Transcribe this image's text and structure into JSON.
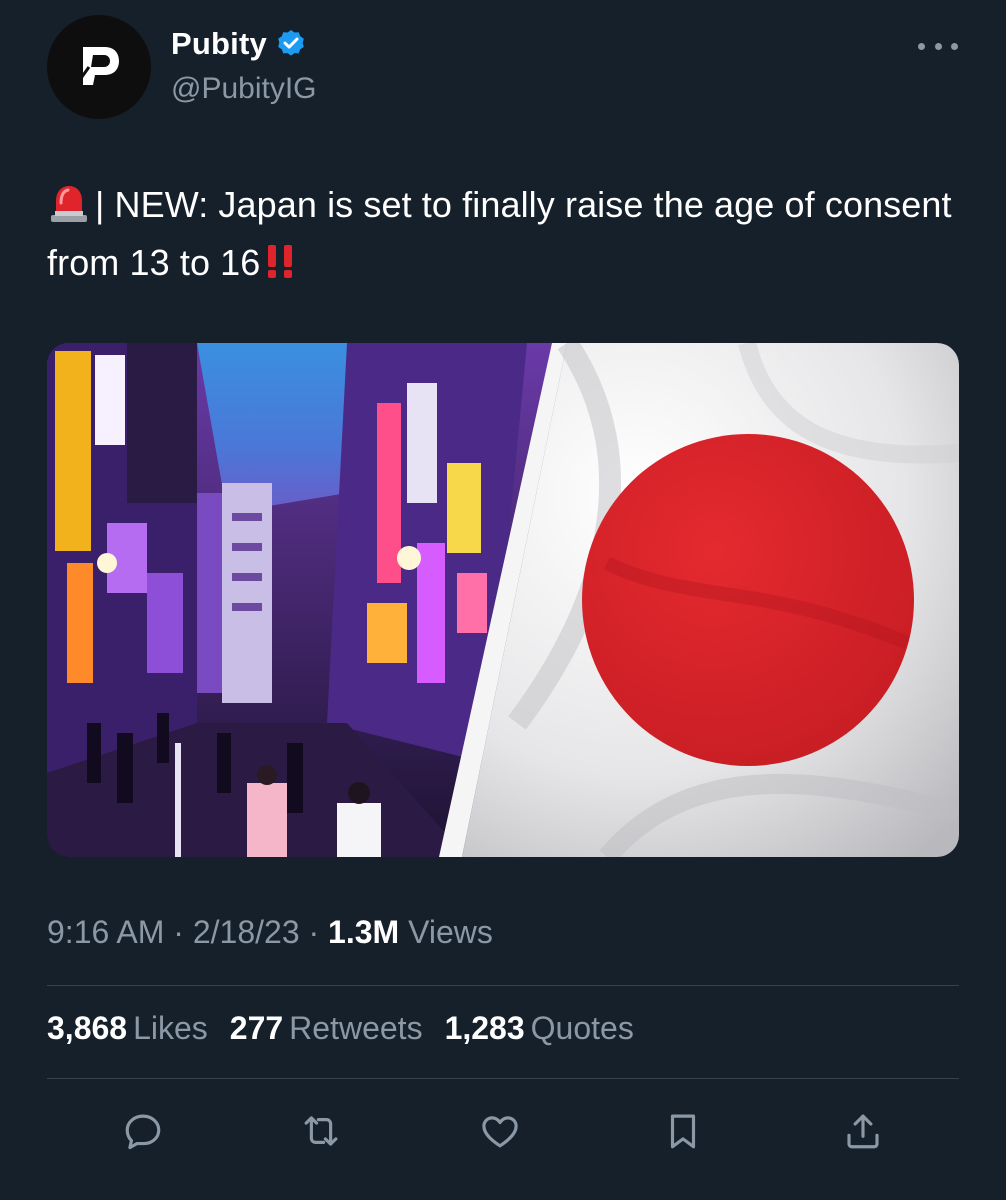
{
  "author": {
    "display_name": "Pubity",
    "handle": "@PubityIG",
    "verified": true,
    "avatar_icon": "pubity-logo-icon"
  },
  "tweet": {
    "text_prefix": "| NEW: Japan is set to finally raise the age of consent from 13 to 16",
    "leading_emoji": "police-light-emoji",
    "trailing_emoji": "double-exclamation-emoji"
  },
  "media": {
    "left_image": "tokyo-neon-street-photo",
    "right_image": "japan-flag-photo"
  },
  "meta": {
    "time": "9:16 AM",
    "sep1": " · ",
    "date": "2/18/23",
    "sep2": " · ",
    "views_count": "1.3M",
    "views_label": "Views"
  },
  "stats": {
    "likes_count": "3,868",
    "likes_label": "Likes",
    "retweets_count": "277",
    "retweets_label": "Retweets",
    "quotes_count": "1,283",
    "quotes_label": "Quotes"
  },
  "actions": [
    "reply-icon",
    "retweet-icon",
    "like-icon",
    "bookmark-icon",
    "share-icon"
  ],
  "colors": {
    "background": "#15202b",
    "text_primary": "#ffffff",
    "text_secondary": "#8b98a5",
    "verified_blue": "#1d9bf0",
    "flag_red": "#d0202a",
    "divider": "#38444d"
  }
}
